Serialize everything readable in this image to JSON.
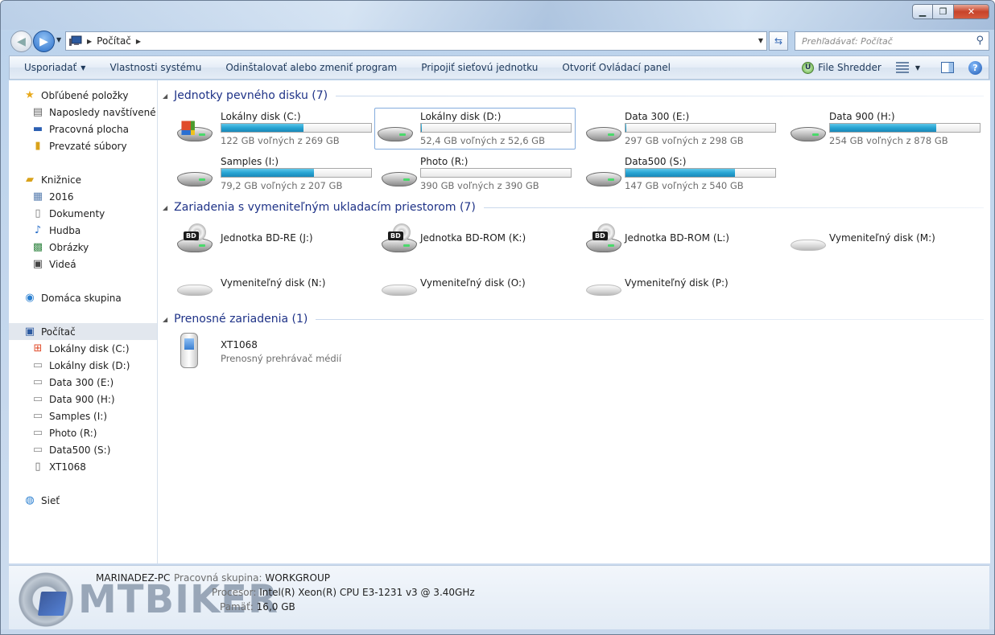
{
  "address": {
    "crumb": "Počítač",
    "search_placeholder": "Prehľadávať: Počítač"
  },
  "toolbar": {
    "organize": "Usporiadať",
    "system_properties": "Vlastnosti systému",
    "uninstall": "Odinštalovať alebo zmeniť program",
    "map_drive": "Pripojiť sieťovú jednotku",
    "control_panel": "Otvoriť Ovládací panel",
    "file_shredder": "File Shredder"
  },
  "sidebar": {
    "favorites": "Obľúbené položky",
    "recent": "Naposledy navštívené mi",
    "desktop": "Pracovná plocha",
    "downloads": "Prevzaté súbory",
    "libraries": "Knižnice",
    "lib_2016": "2016",
    "documents": "Dokumenty",
    "music": "Hudba",
    "pictures": "Obrázky",
    "videos": "Videá",
    "homegroup": "Domáca skupina",
    "computer": "Počítač",
    "drive_c": "Lokálny disk (C:)",
    "drive_d": "Lokálny disk (D:)",
    "drive_e": "Data 300 (E:)",
    "drive_h": "Data 900 (H:)",
    "drive_i": "Samples (I:)",
    "drive_r": "Photo (R:)",
    "drive_s": "Data500 (S:)",
    "xt1068": "XT1068",
    "network": "Sieť"
  },
  "groups": {
    "hdd": "Jednotky pevného disku (7)",
    "removable": "Zariadenia s vymeniteľným ukladacím priestorom (7)",
    "portable": "Prenosné zariadenia (1)"
  },
  "drives": [
    {
      "name": "Lokálny disk (C:)",
      "free": "122 GB voľných z 269 GB",
      "used_fraction": 0.55
    },
    {
      "name": "Lokálny disk (D:)",
      "free": "52,4 GB voľných z 52,6 GB",
      "used_fraction": 0.004
    },
    {
      "name": "Data 300 (E:)",
      "free": "297 GB voľných z 298 GB",
      "used_fraction": 0.003
    },
    {
      "name": "Data 900 (H:)",
      "free": "254 GB voľných z 878 GB",
      "used_fraction": 0.71
    },
    {
      "name": "Samples (I:)",
      "free": "79,2 GB voľných z 207 GB",
      "used_fraction": 0.62
    },
    {
      "name": "Photo (R:)",
      "free": "390 GB voľných z 390 GB",
      "used_fraction": 0.0
    },
    {
      "name": "Data500 (S:)",
      "free": "147 GB voľných z 540 GB",
      "used_fraction": 0.73
    }
  ],
  "removable": [
    "Jednotka BD-RE (J:)",
    "Jednotka BD-ROM (K:)",
    "Jednotka BD-ROM (L:)",
    "Vymeniteľný disk (M:)",
    "Vymeniteľný disk (N:)",
    "Vymeniteľný disk (O:)",
    "Vymeniteľný disk (P:)"
  ],
  "bd_label": "BD",
  "portable": {
    "name": "XT1068",
    "type": "Prenosný prehrávač médií"
  },
  "details": {
    "pc_name": "MARINADEZ-PC",
    "workgroup_label": "Pracovná skupina:",
    "workgroup": "WORKGROUP",
    "cpu_label": "Procesor:",
    "cpu": "Intel(R) Xeon(R) CPU E3-1231 v3 @ 3.40GHz",
    "ram_label": "Pamäť:",
    "ram": "16,0 GB"
  },
  "watermark": "MTBIKER"
}
